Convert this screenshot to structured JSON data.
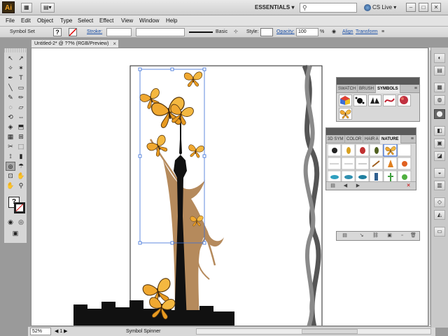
{
  "app": {
    "logo_text": "Ai",
    "workspace": "ESSENTIALS",
    "workspace_caret": "▾",
    "cs_live": "CS Live",
    "cs_live_caret": "▾",
    "window_buttons": [
      "–",
      "□",
      "✕"
    ]
  },
  "menu": {
    "items": [
      "File",
      "Edit",
      "Object",
      "Type",
      "Select",
      "Effect",
      "View",
      "Window",
      "Help"
    ]
  },
  "control": {
    "selection_label": "Symbol Set",
    "fill_glyph": "?",
    "stroke_label": "Stroke:",
    "stroke_style": "Basic",
    "style_label": "Style:",
    "opacity_label": "Opacity:",
    "opacity_value": "100",
    "opacity_unit": "%",
    "align_label": "Align",
    "transform_label": "Transform"
  },
  "tools": {
    "glyphs": [
      "↖",
      "↗",
      "✧",
      "✶",
      "✒",
      "T",
      "╲",
      "▭",
      "✎",
      "✏",
      "◌",
      "▱",
      "⟲",
      "⇔",
      "◈",
      "⬒",
      "▦",
      "⊞",
      "✂",
      "⬚",
      "⟟",
      "▮",
      "☂",
      "⊡",
      "✋",
      "⚲"
    ],
    "active_glyph": "⊚",
    "fill_glyph": "?",
    "mode_glyphs": [
      "◉",
      "◎",
      "▣"
    ]
  },
  "document": {
    "tab_title": "Untitled-2* @ ??% (RGB/Preview)",
    "tab_close": "×"
  },
  "status": {
    "zoom": "52%",
    "current_tool": "Symbol Spinner"
  },
  "symbols_panel": {
    "tabs": [
      "SWATCH",
      "BRUSH",
      "SYMBOLS"
    ],
    "active_tab": "SYMBOLS",
    "menu_glyph": "≡"
  },
  "nature_panel": {
    "tabs": [
      "3D SYM",
      "COLOR",
      "HAIR A",
      "NATURE"
    ],
    "active_tab": "NATURE",
    "menu_glyph": "≡",
    "close_glyph": "✕"
  },
  "dock": {
    "icons": [
      "◐",
      "▤",
      "▦",
      "◍",
      "⬤",
      "◧",
      "▣",
      "◪",
      "◒",
      "▥",
      "◇",
      "◭",
      "▭"
    ]
  },
  "colors": {
    "tree": "#b58a5c",
    "butterfly": "#f0a830",
    "butterfly_dark": "#5a3a10",
    "tower": "#111111",
    "ribbon_1": "#555555",
    "ribbon_2": "#8a8a8a",
    "selection": "#3a6fd8"
  }
}
